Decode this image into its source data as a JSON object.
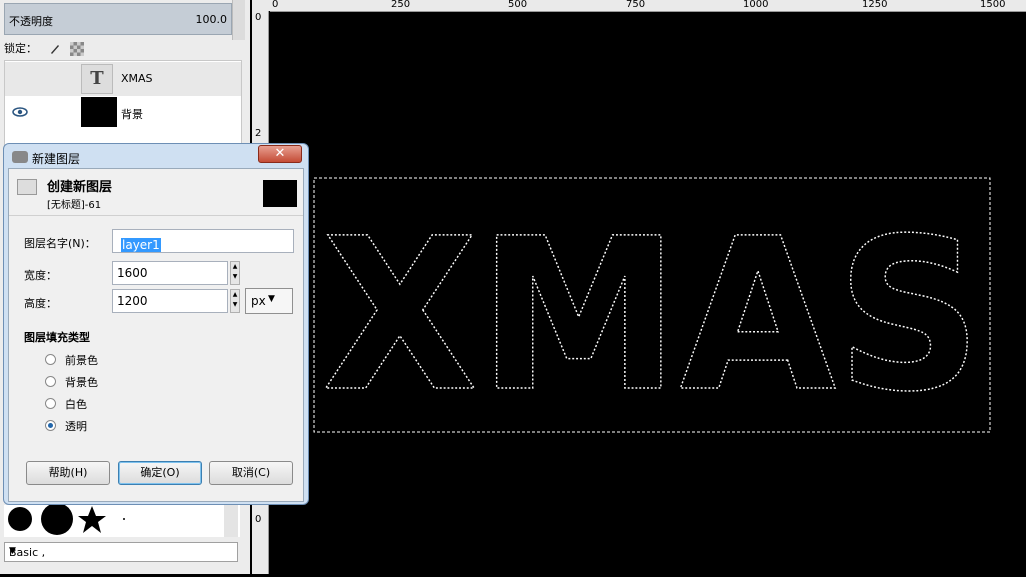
{
  "layers_panel": {
    "opacity_label": "不透明度",
    "opacity_value": "100.0",
    "lock_label": "锁定：",
    "layers": [
      {
        "name": "XMAS",
        "thumb": "T"
      },
      {
        "name": "背景"
      }
    ]
  },
  "brushes_panel": {
    "preset": "Basic ,"
  },
  "ruler": {
    "h_ticks": [
      "0",
      "250",
      "500",
      "750",
      "1000",
      "1250",
      "1500"
    ],
    "v_ticks": [
      "0",
      "2",
      "0"
    ]
  },
  "canvas": {
    "text": "XMAS"
  },
  "dialog": {
    "title": "新建图层",
    "header_title": "创建新图层",
    "header_subtitle": "[无标题]-61",
    "close": "✕",
    "name_label": "图层名字(N)：",
    "name_value": "layer1",
    "width_label": "宽度：",
    "width_value": "1600",
    "height_label": "高度：",
    "height_value": "1200",
    "unit": "px",
    "fill_type_label": "图层填充类型",
    "fill_options": [
      "前景色",
      "背景色",
      "白色",
      "透明"
    ],
    "fill_selected": 3,
    "buttons": {
      "help": "帮助(H)",
      "ok": "确定(O)",
      "cancel": "取消(C)"
    }
  },
  "colors": {
    "canvas_bg": "#000000",
    "selection": "#ffffff",
    "title_bar": "#cfe0f2"
  }
}
